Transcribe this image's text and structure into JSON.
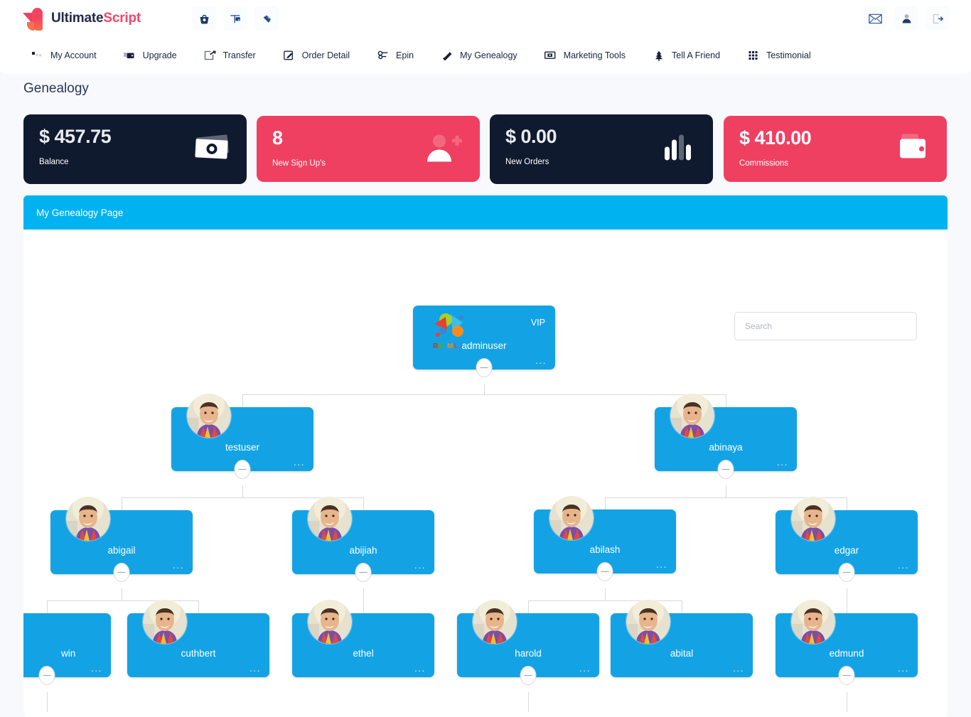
{
  "brand": {
    "name_part1": "Ultimate",
    "name_part2": "Script"
  },
  "topbar": {
    "icons": [
      {
        "name": "basket-icon",
        "glyph": "basket"
      },
      {
        "name": "banner-icon",
        "glyph": "banner"
      },
      {
        "name": "ticket-icon",
        "glyph": "ticket"
      }
    ],
    "right_icons": [
      {
        "name": "mail-icon",
        "glyph": "mail"
      },
      {
        "name": "user-icon",
        "glyph": "user"
      },
      {
        "name": "logout-icon",
        "glyph": "logout"
      }
    ]
  },
  "nav": {
    "items": [
      {
        "label": "My Account",
        "icon": "dashboard-icon"
      },
      {
        "label": "Upgrade",
        "icon": "upgrade-icon"
      },
      {
        "label": "Transfer",
        "icon": "transfer-icon"
      },
      {
        "label": "Order Detail",
        "icon": "order-detail-icon"
      },
      {
        "label": "Epin",
        "icon": "epin-icon"
      },
      {
        "label": "My Genealogy",
        "icon": "genealogy-icon"
      },
      {
        "label": "Marketing Tools",
        "icon": "marketing-tools-icon"
      },
      {
        "label": "Tell A Friend",
        "icon": "tell-a-friend-icon"
      },
      {
        "label": "Testimonial",
        "icon": "testimonial-icon"
      }
    ]
  },
  "page": {
    "title": "Genealogy"
  },
  "stats": [
    {
      "value": "$ 457.75",
      "label": "Balance",
      "theme": "dark",
      "icon": "cash-icon"
    },
    {
      "value": "8",
      "label": "New Sign Up's",
      "theme": "pink",
      "icon": "add-user-icon"
    },
    {
      "value": "$ 0.00",
      "label": "New Orders",
      "theme": "dark",
      "icon": "bar-chart-icon"
    },
    {
      "value": "$ 410.00",
      "label": "Commissions",
      "theme": "pink",
      "icon": "wallet-icon"
    }
  ],
  "colors": {
    "dark_card": "#101a2e",
    "pink_card": "#ef4061",
    "panel_header": "#00b3f0",
    "node_blue": "#13a3e5",
    "brand_pink": "#f4456a",
    "page_bg": "#f7f9fc"
  },
  "panel": {
    "header": "My Genealogy Page"
  },
  "search": {
    "value": "",
    "placeholder": "Search"
  },
  "tree": {
    "nodes": [
      {
        "id": "adminuser",
        "name": "adminuser",
        "badge": "VIP",
        "avatar": "logo",
        "menu": "...",
        "has_toggle": true
      },
      {
        "id": "testuser",
        "name": "testuser",
        "badge": "",
        "avatar": "photo",
        "menu": "...",
        "has_toggle": true
      },
      {
        "id": "abinaya",
        "name": "abinaya",
        "badge": "",
        "avatar": "photo",
        "menu": "...",
        "has_toggle": true
      },
      {
        "id": "abigail",
        "name": "abigail",
        "badge": "",
        "avatar": "photo",
        "menu": "...",
        "has_toggle": true
      },
      {
        "id": "abijiah",
        "name": "abijiah",
        "badge": "",
        "avatar": "photo",
        "menu": "...",
        "has_toggle": true
      },
      {
        "id": "abilash",
        "name": "abilash",
        "badge": "",
        "avatar": "photo",
        "menu": "...",
        "has_toggle": true
      },
      {
        "id": "edgar",
        "name": "edgar",
        "badge": "",
        "avatar": "photo",
        "menu": "...",
        "has_toggle": true
      },
      {
        "id": "win",
        "name": "win",
        "badge": "",
        "avatar": "none",
        "menu": "...",
        "has_toggle": true
      },
      {
        "id": "cuthbert",
        "name": "cuthbert",
        "badge": "",
        "avatar": "photo",
        "menu": "...",
        "has_toggle": false
      },
      {
        "id": "ethel",
        "name": "ethel",
        "badge": "",
        "avatar": "photo",
        "menu": "...",
        "has_toggle": false
      },
      {
        "id": "harold",
        "name": "harold",
        "badge": "",
        "avatar": "photo",
        "menu": "...",
        "has_toggle": true
      },
      {
        "id": "abital",
        "name": "abital",
        "badge": "",
        "avatar": "photo",
        "menu": "...",
        "has_toggle": false
      },
      {
        "id": "edmund",
        "name": "edmund",
        "badge": "",
        "avatar": "photo",
        "menu": "...",
        "has_toggle": true
      }
    ]
  }
}
